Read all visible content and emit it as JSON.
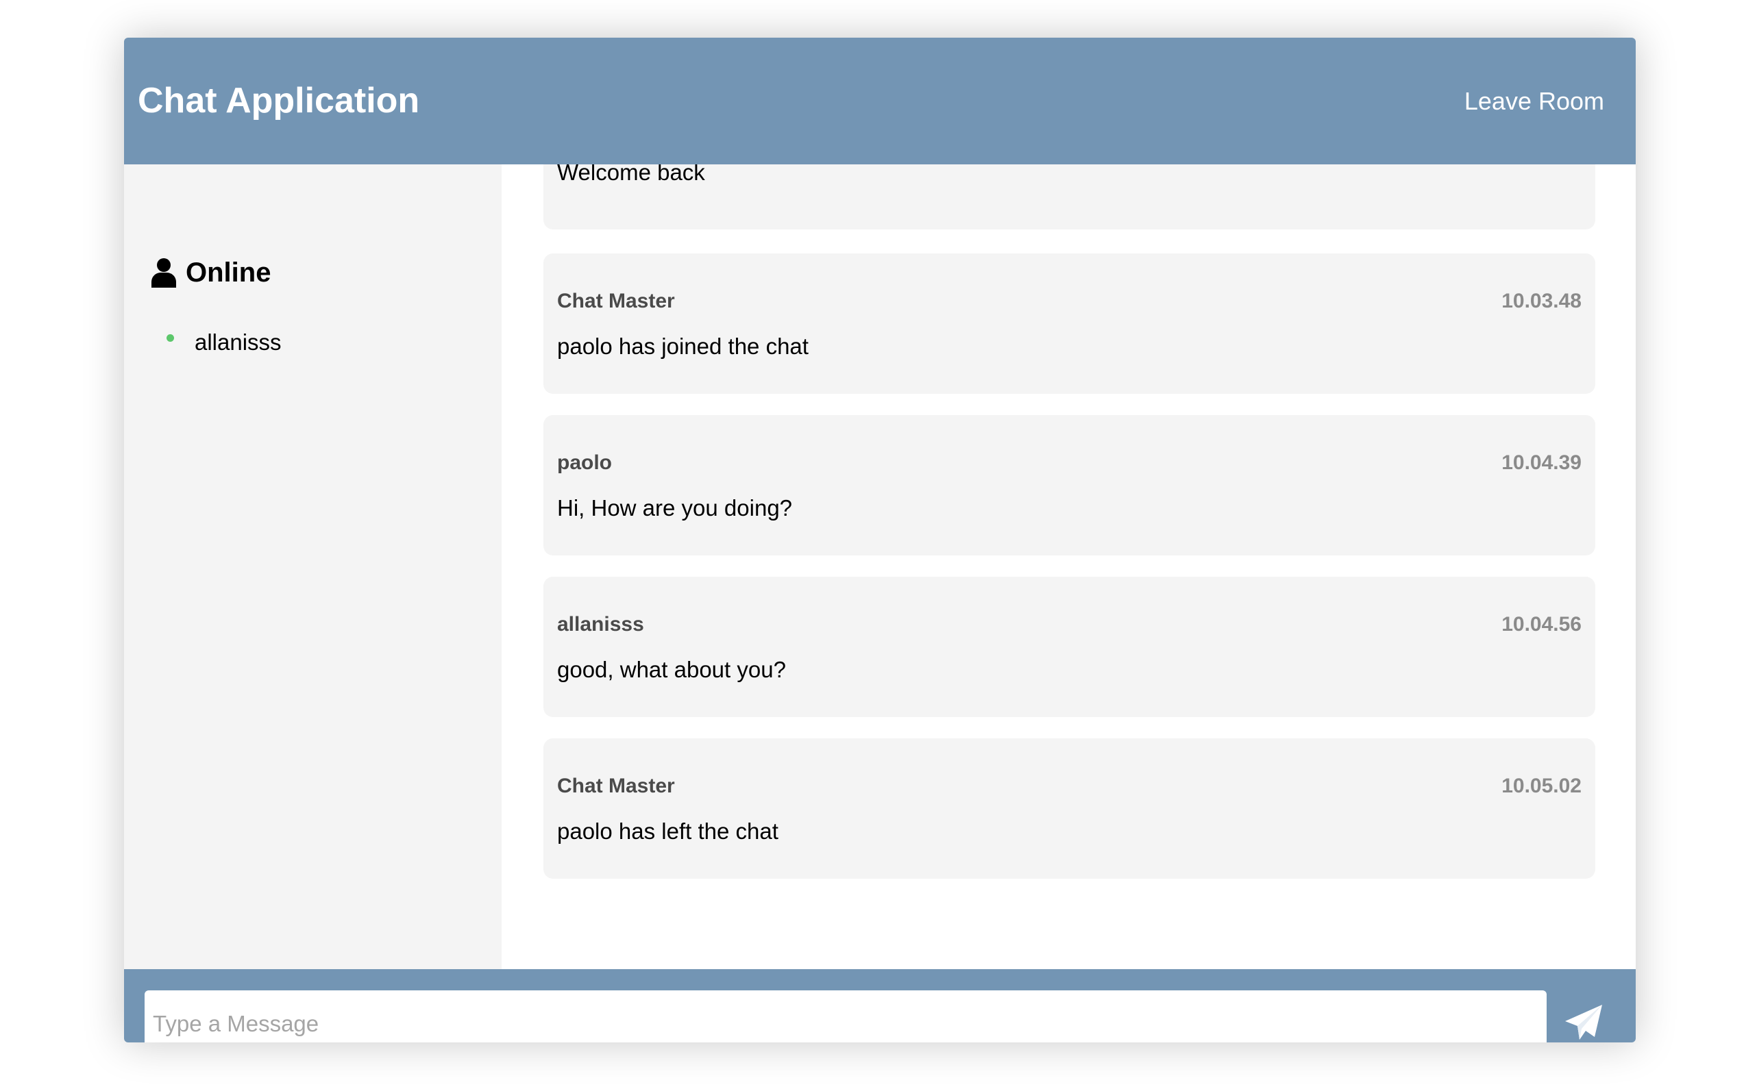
{
  "header": {
    "title": "Chat Application",
    "leave_label": "Leave Room"
  },
  "sidebar": {
    "heading_icon": "user-icon",
    "heading": "Online",
    "users": [
      {
        "name": "allanisss",
        "status_color": "#5cc76b"
      }
    ]
  },
  "messages": [
    {
      "sender": "",
      "time": "",
      "text": "Welcome back"
    },
    {
      "sender": "Chat Master",
      "time": "10.03.48",
      "text": "paolo has joined the chat"
    },
    {
      "sender": "paolo",
      "time": "10.04.39",
      "text": "Hi, How are you doing?"
    },
    {
      "sender": "allanisss",
      "time": "10.04.56",
      "text": "good, what about you?"
    },
    {
      "sender": "Chat Master",
      "time": "10.05.02",
      "text": "paolo has left the chat"
    }
  ],
  "composer": {
    "placeholder": "Type a Message",
    "value": "",
    "send_icon": "paper-plane-icon"
  },
  "colors": {
    "header": "#7395b4",
    "sidebar": "#f4f4f4",
    "message_bubble": "#f4f4f4",
    "online_dot": "#5cc76b"
  }
}
